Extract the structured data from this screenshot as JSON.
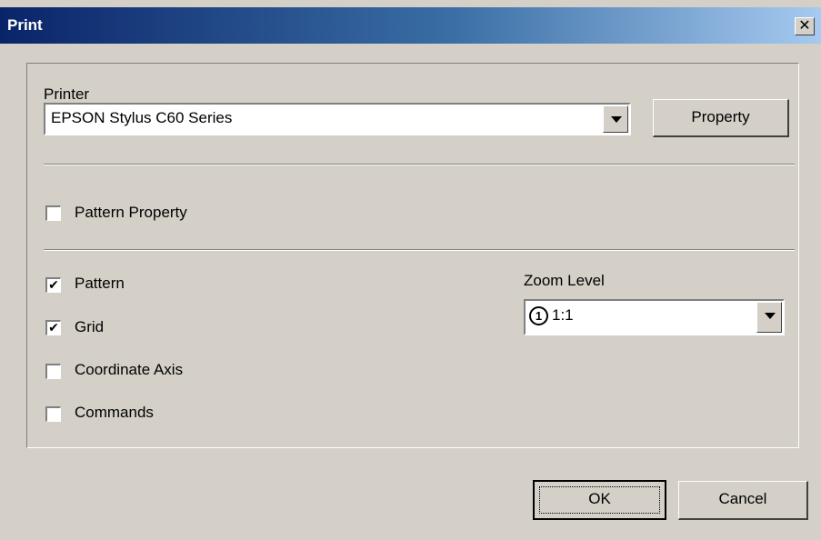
{
  "window": {
    "title": "Print",
    "close_glyph": "✕"
  },
  "printer": {
    "label": "Printer",
    "selected": "EPSON Stylus C60 Series",
    "property_button": "Property"
  },
  "pattern_property": {
    "label": "Pattern Property",
    "checked": false
  },
  "options": [
    {
      "label": "Pattern",
      "checked": true
    },
    {
      "label": "Grid",
      "checked": true
    },
    {
      "label": "Coordinate Axis",
      "checked": false
    },
    {
      "label": "Commands",
      "checked": false
    }
  ],
  "zoom": {
    "label": "Zoom Level",
    "icon": "1",
    "selected": "1:1"
  },
  "buttons": {
    "ok": "OK",
    "cancel": "Cancel"
  }
}
